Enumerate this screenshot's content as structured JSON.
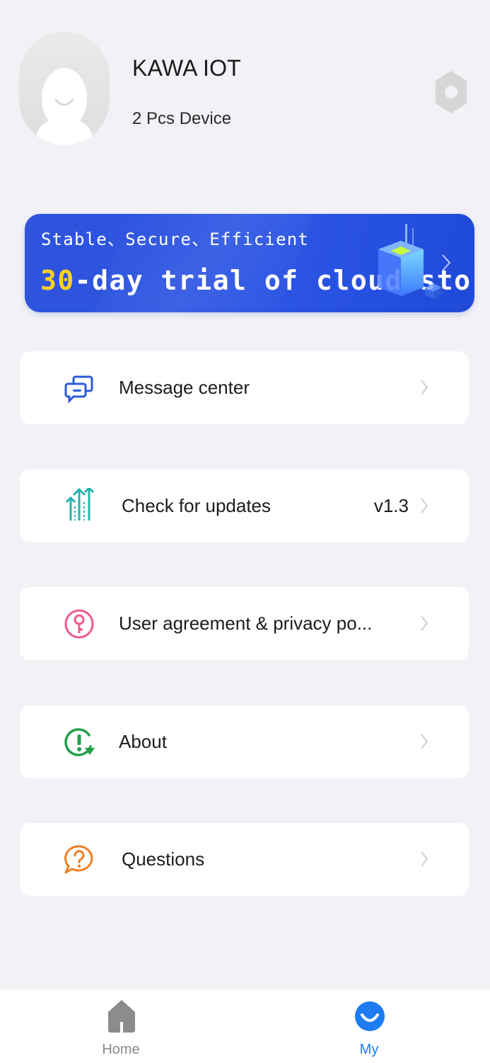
{
  "profile": {
    "name": "KAWA IOT",
    "device_count": "2 Pcs Device",
    "avatar_icon": "default-avatar-icon",
    "settings_icon": "settings-hexagon-icon"
  },
  "banner": {
    "subtitle": "Stable、Secure、Efficient",
    "highlight": "30",
    "title_rest": "-day trial of cloud storage",
    "accent_color": "#2c55e4",
    "highlight_color": "#ffd21f"
  },
  "menu": {
    "items": [
      {
        "label": "Message center",
        "icon": "message-icon",
        "value": ""
      },
      {
        "label": "Check for updates",
        "icon": "update-arrows-icon",
        "value": "v1.3"
      },
      {
        "label": "User agreement & privacy po...",
        "icon": "key-icon",
        "value": ""
      },
      {
        "label": "About",
        "icon": "about-info-icon",
        "value": ""
      },
      {
        "label": "Questions",
        "icon": "question-icon",
        "value": ""
      }
    ]
  },
  "tabbar": {
    "tabs": [
      {
        "label": "Home",
        "icon": "home-icon",
        "active": false
      },
      {
        "label": "My",
        "icon": "my-profile-icon",
        "active": true
      }
    ],
    "active_color": "#1e7cf2",
    "inactive_color": "#8a8a8a"
  }
}
